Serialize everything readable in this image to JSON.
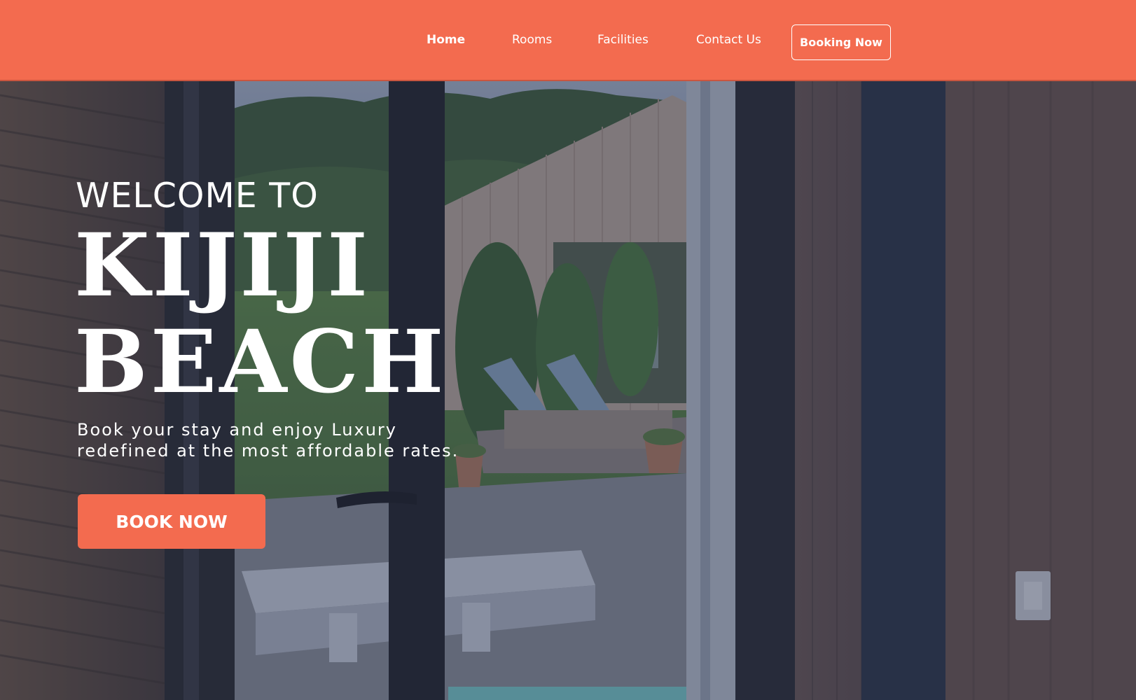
{
  "nav": {
    "items": [
      {
        "label": "Home"
      },
      {
        "label": "Rooms"
      },
      {
        "label": "Facilities"
      },
      {
        "label": "Contact Us"
      }
    ],
    "booking_label": "Booking Now"
  },
  "hero": {
    "welcome": "WELCOME TO",
    "title_line1": "KIJIJI",
    "title_line2": "BEACH",
    "subtitle_line1": "Book your stay and enjoy Luxury",
    "subtitle_line2": "redefined at the most affordable rates.",
    "cta_label": "BOOK NOW"
  },
  "colors": {
    "brand": "#f36b4f",
    "text": "#ffffff",
    "overlay": "#222c48"
  }
}
